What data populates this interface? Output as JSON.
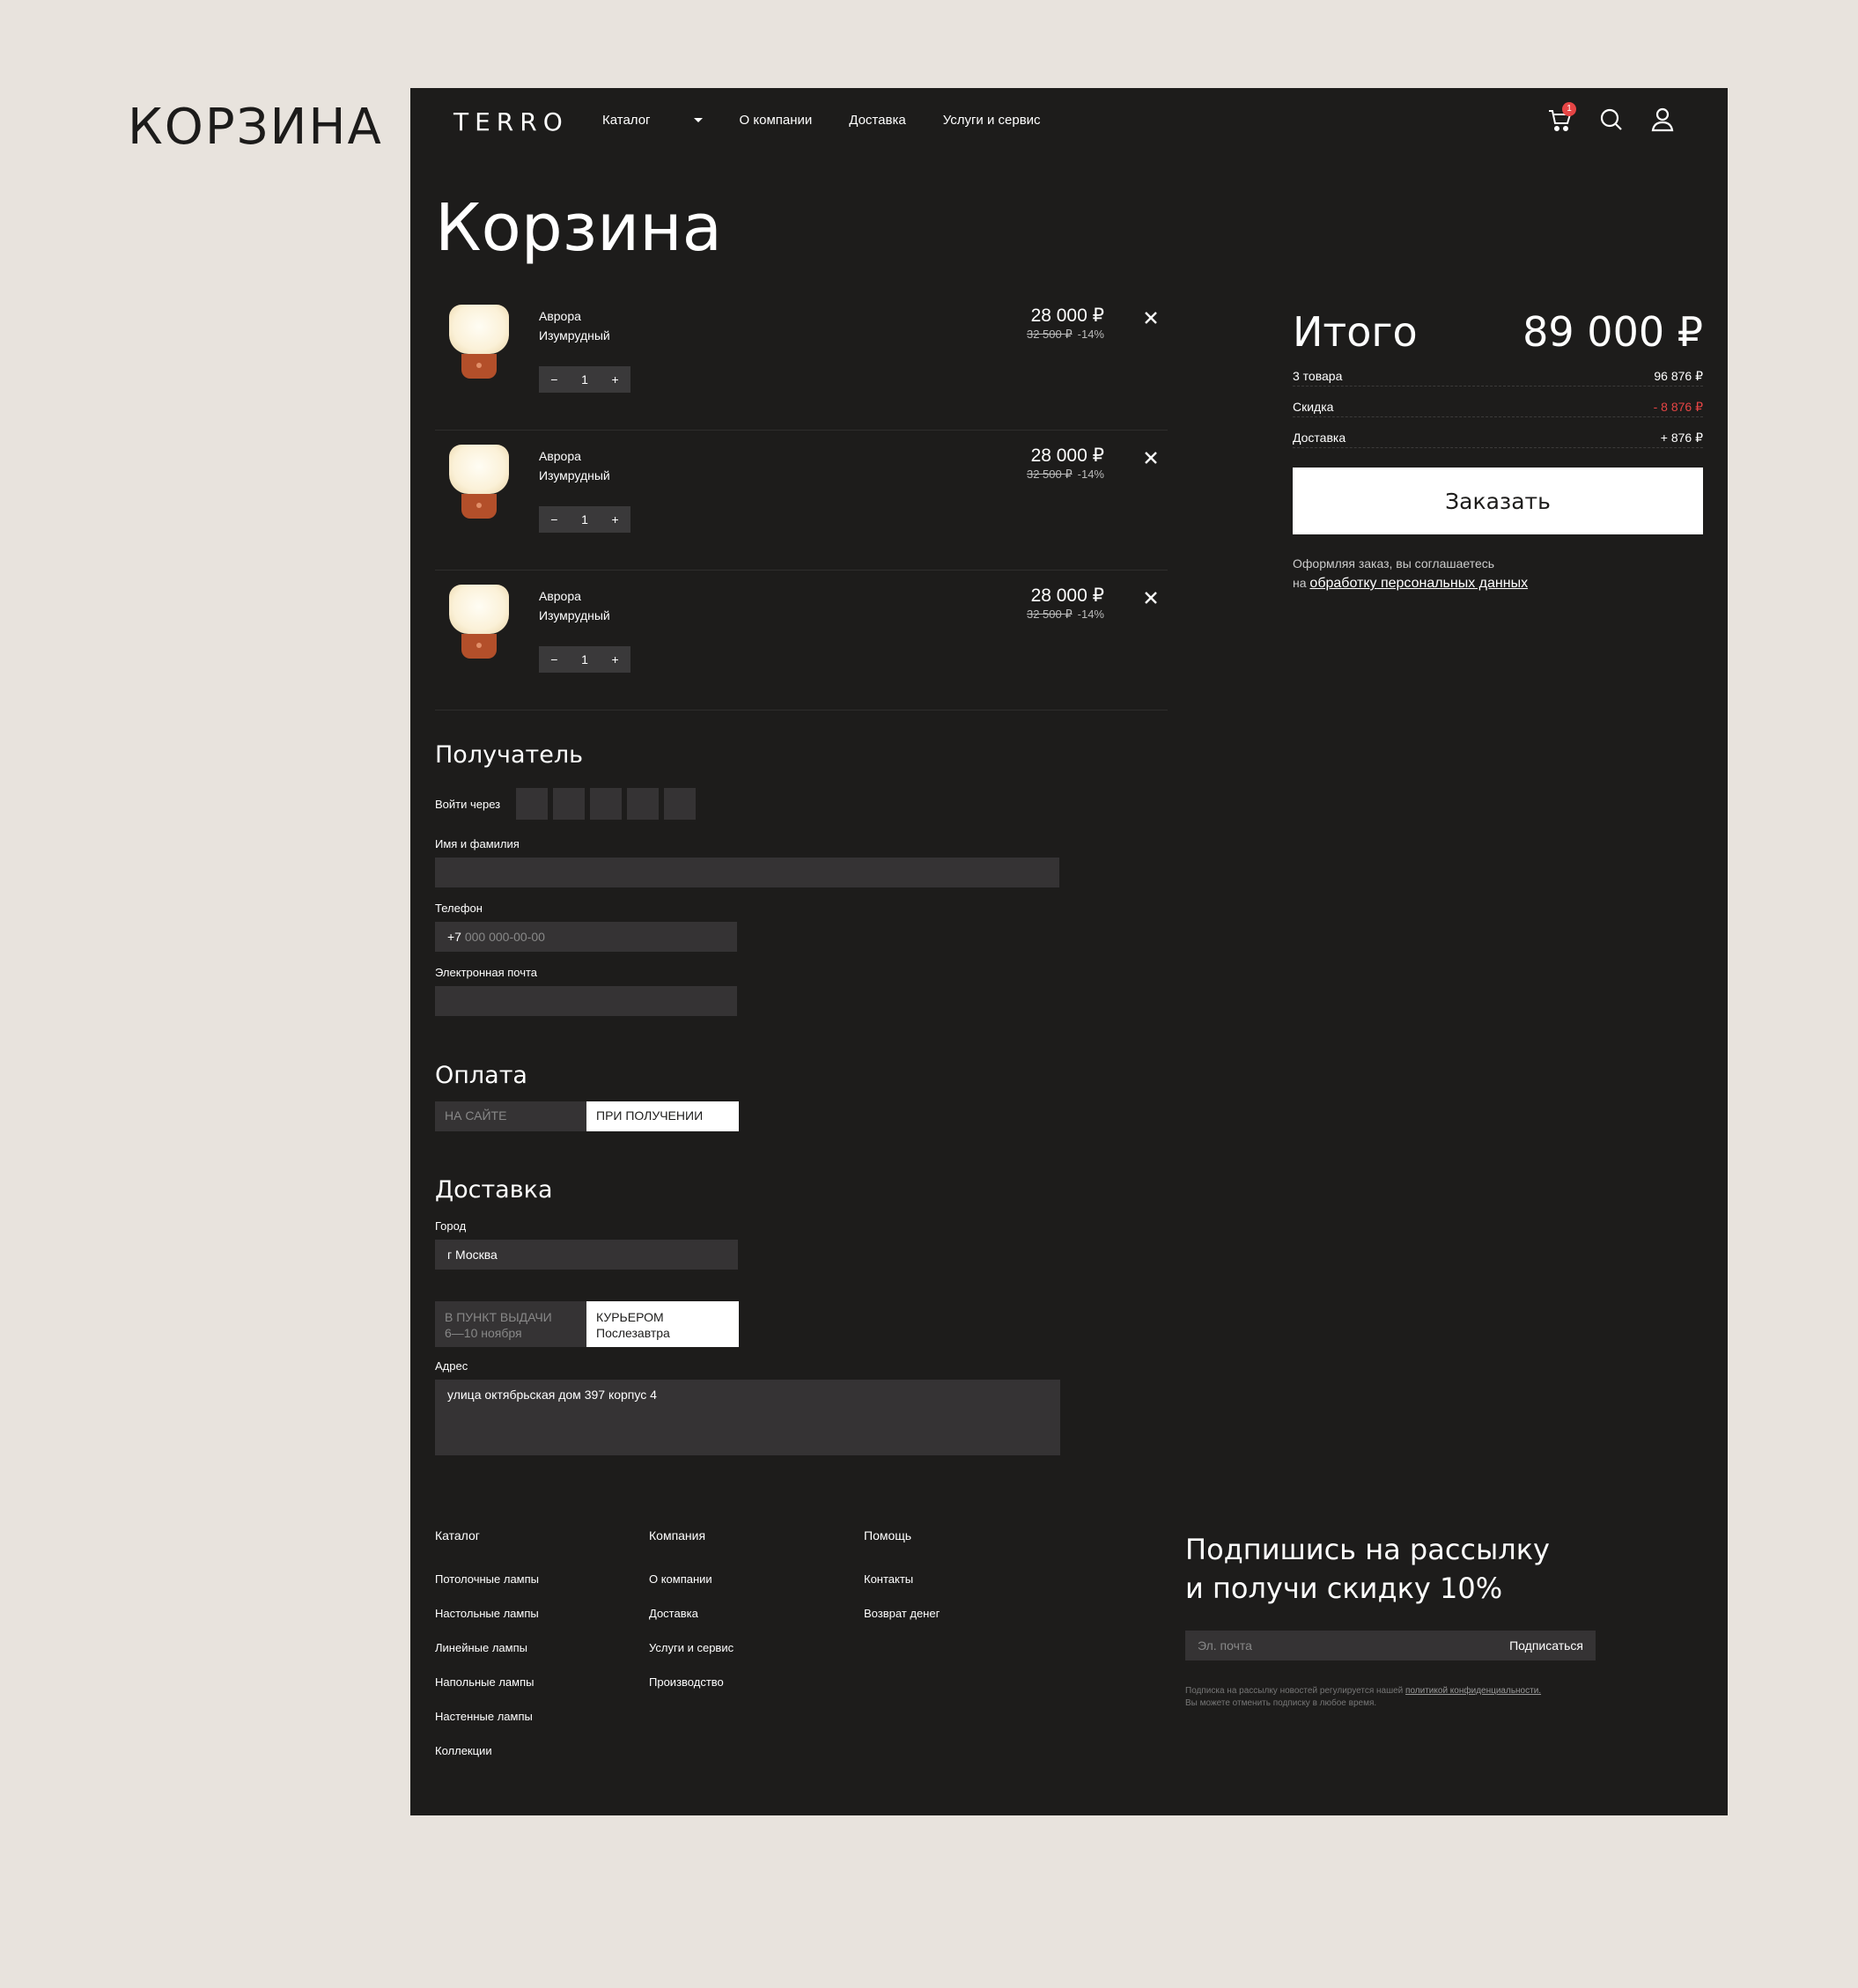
{
  "side_title": "КОРЗИНА",
  "header": {
    "logo": "TERRO",
    "nav": [
      "Каталог",
      "О компании",
      "Доставка",
      "Услуги и сервис"
    ],
    "cart_count": "1"
  },
  "page_title": "Корзина",
  "cart": {
    "items": [
      {
        "name": "Аврора",
        "variant": "Изумрудный",
        "qty": "1",
        "minus": "−",
        "plus": "+",
        "price": "28 000 ₽",
        "old_price": "32 500 ₽",
        "discount": "-14%"
      },
      {
        "name": "Аврора",
        "variant": "Изумрудный",
        "qty": "1",
        "minus": "−",
        "plus": "+",
        "price": "28 000 ₽",
        "old_price": "32 500 ₽",
        "discount": "-14%"
      },
      {
        "name": "Аврора",
        "variant": "Изумрудный",
        "qty": "1",
        "minus": "−",
        "plus": "+",
        "price": "28 000 ₽",
        "old_price": "32 500 ₽",
        "discount": "-14%"
      }
    ]
  },
  "summary": {
    "title": "Итого",
    "total": "89 000 ₽",
    "rows": [
      {
        "label": "3 товара",
        "value": "96 876 ₽"
      },
      {
        "label": "Скидка",
        "value": "- 8 876 ₽"
      },
      {
        "label": "Доставка",
        "value": "+ 876 ₽"
      }
    ],
    "order_button": "Заказать",
    "agree_text": "Оформляя заказ, вы соглашаетесь",
    "agree_prefix": "на",
    "agree_link": "обработку персональных данных"
  },
  "recipient": {
    "title": "Получатель",
    "login_via": "Войти через",
    "name_label": "Имя и фамилия",
    "phone_label": "Телефон",
    "phone_prefix": "+7",
    "phone_placeholder": "000 000-00-00",
    "email_label": "Электронная почта"
  },
  "payment": {
    "title": "Оплата",
    "option_site": "НА САЙТЕ",
    "option_receive": "ПРИ ПОЛУЧЕНИИ"
  },
  "delivery": {
    "title": "Доставка",
    "city_label": "Город",
    "city_value": "г Москва",
    "pickup_label": "В ПУНКТ ВЫДАЧИ",
    "pickup_date": "6—10 ноября",
    "courier_label": "КУРЬЕРОМ",
    "courier_date": "Послезавтра",
    "address_label": "Адрес",
    "address_value": "улица октябрьская дом 397 корпус 4"
  },
  "footer": {
    "catalog": {
      "head": "Каталог",
      "links": [
        "Потолочные лампы",
        "Настольные лампы",
        "Линейные лампы",
        "Напольные лампы",
        "Настенные лампы",
        "Коллекции"
      ]
    },
    "company": {
      "head": "Компания",
      "links": [
        "О компании",
        "Доставка",
        "Услуги и сервис",
        "Производство"
      ]
    },
    "help": {
      "head": "Помощь",
      "links": [
        "Контакты",
        "Возврат денег"
      ]
    }
  },
  "subscribe": {
    "title_line1": "Подпишись на рассылку",
    "title_line2": "и получи скидку 10%",
    "email_placeholder": "Эл. почта",
    "button": "Подписаться",
    "note_line1": "Подписка на рассылку новостей регулируется нашей",
    "note_link": "политикой конфиденциальности.",
    "note_line2": "Вы можете отменить подписку в любое время."
  }
}
